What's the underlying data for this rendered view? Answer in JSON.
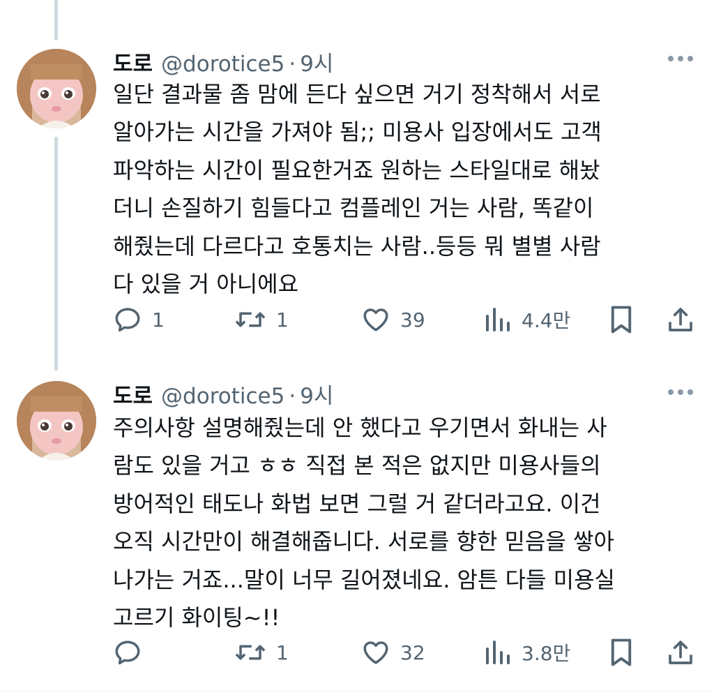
{
  "tweets": [
    {
      "author_name": "도로",
      "handle": "@dorotice5",
      "separator": "·",
      "time": "9시",
      "lines": [
        "일단 결과물 좀 맘에 든다 싶으면 거기 정착해서 서로",
        "알아가는 시간을 가져야 됨;; 미용사 입장에서도 고객",
        "파악하는 시간이 필요한거죠 원하는 스타일대로 해놨",
        "더니 손질하기 힘들다고 컴플레인 거는 사람, 똑같이",
        "해줬는데 다르다고 호통치는 사람..등등 뭐 별별 사람",
        "다 있을 거 아니에요"
      ],
      "replies": "1",
      "retweets": "1",
      "likes": "39",
      "views": "4.4만"
    },
    {
      "author_name": "도로",
      "handle": "@dorotice5",
      "separator": "·",
      "time": "9시",
      "lines": [
        "주의사항 설명해줬는데 안 했다고 우기면서 화내는 사",
        "람도 있을 거고 ㅎㅎ 직접 본 적은 없지만 미용사들의",
        "방어적인 태도나 화법 보면 그럴 거 같더라고요. 이건",
        "오직 시간만이 해결해줍니다. 서로를 향한 믿음을 쌓아",
        "나가는 거죠...말이 너무 길어졌네요. 암튼 다들 미용실",
        "고르기 화이팅~!!"
      ],
      "replies": "",
      "retweets": "1",
      "likes": "32",
      "views": "3.8만"
    }
  ],
  "icons": {
    "avatar": "doll-avatar",
    "more": "more-dots-icon",
    "reply": "reply-icon",
    "retweet": "retweet-icon",
    "like": "heart-icon",
    "views": "views-icon",
    "bookmark": "bookmark-icon",
    "share": "share-icon"
  },
  "colors": {
    "text": "#0f1419",
    "secondary": "#536471",
    "thread_line": "#cfd9de"
  }
}
